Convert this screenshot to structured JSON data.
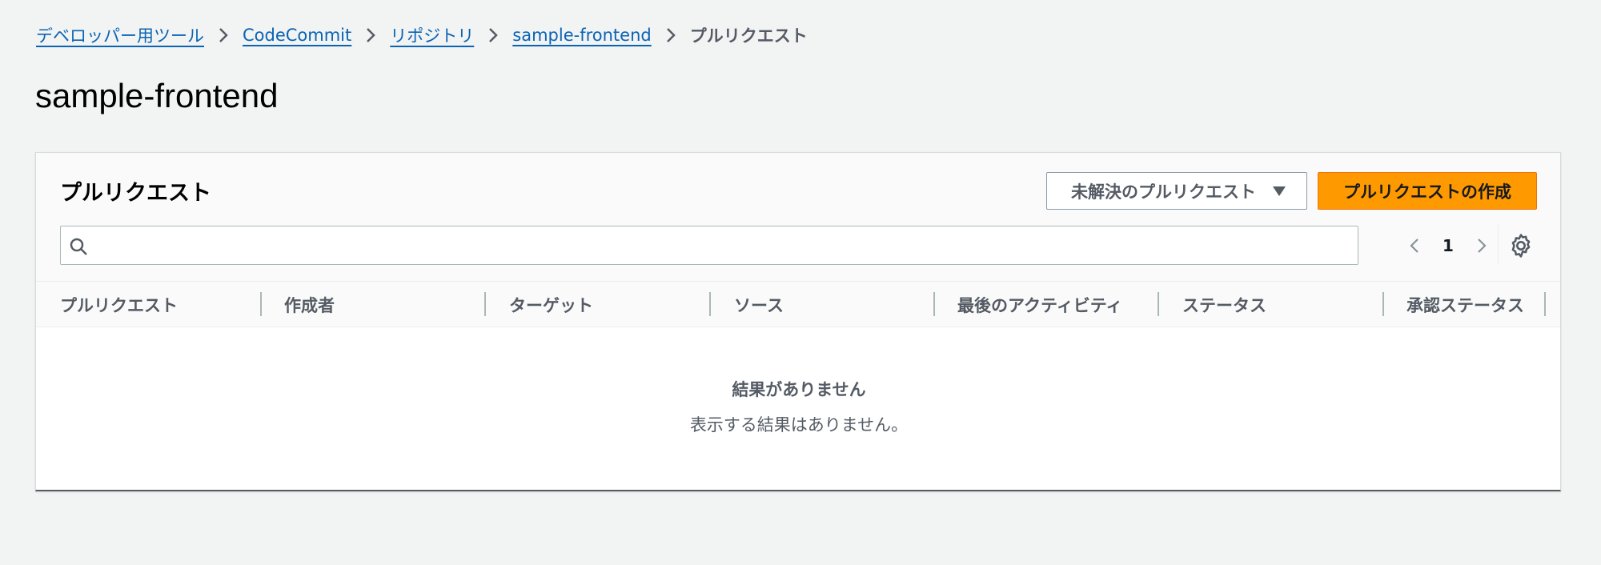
{
  "breadcrumb": {
    "items": [
      {
        "label": "デベロッパー用ツール"
      },
      {
        "label": "CodeCommit"
      },
      {
        "label": "リポジトリ"
      },
      {
        "label": "sample-frontend"
      },
      {
        "label": "プルリクエスト"
      }
    ]
  },
  "page_title": "sample-frontend",
  "section": {
    "title": "プルリクエスト",
    "filter_selected": "未解決のプルリクエスト",
    "create_button": "プルリクエストの作成"
  },
  "search": {
    "placeholder": "",
    "value": ""
  },
  "pagination": {
    "current_page": "1"
  },
  "table": {
    "columns": [
      "プルリクエスト",
      "作成者",
      "ターゲット",
      "ソース",
      "最後のアクティビティ",
      "ステータス",
      "承認ステータス"
    ]
  },
  "empty_state": {
    "title": "結果がありません",
    "description": "表示する結果はありません。"
  },
  "colors": {
    "accent": "#ff9900",
    "link": "#0a64b4",
    "background": "#f2f3f3"
  }
}
